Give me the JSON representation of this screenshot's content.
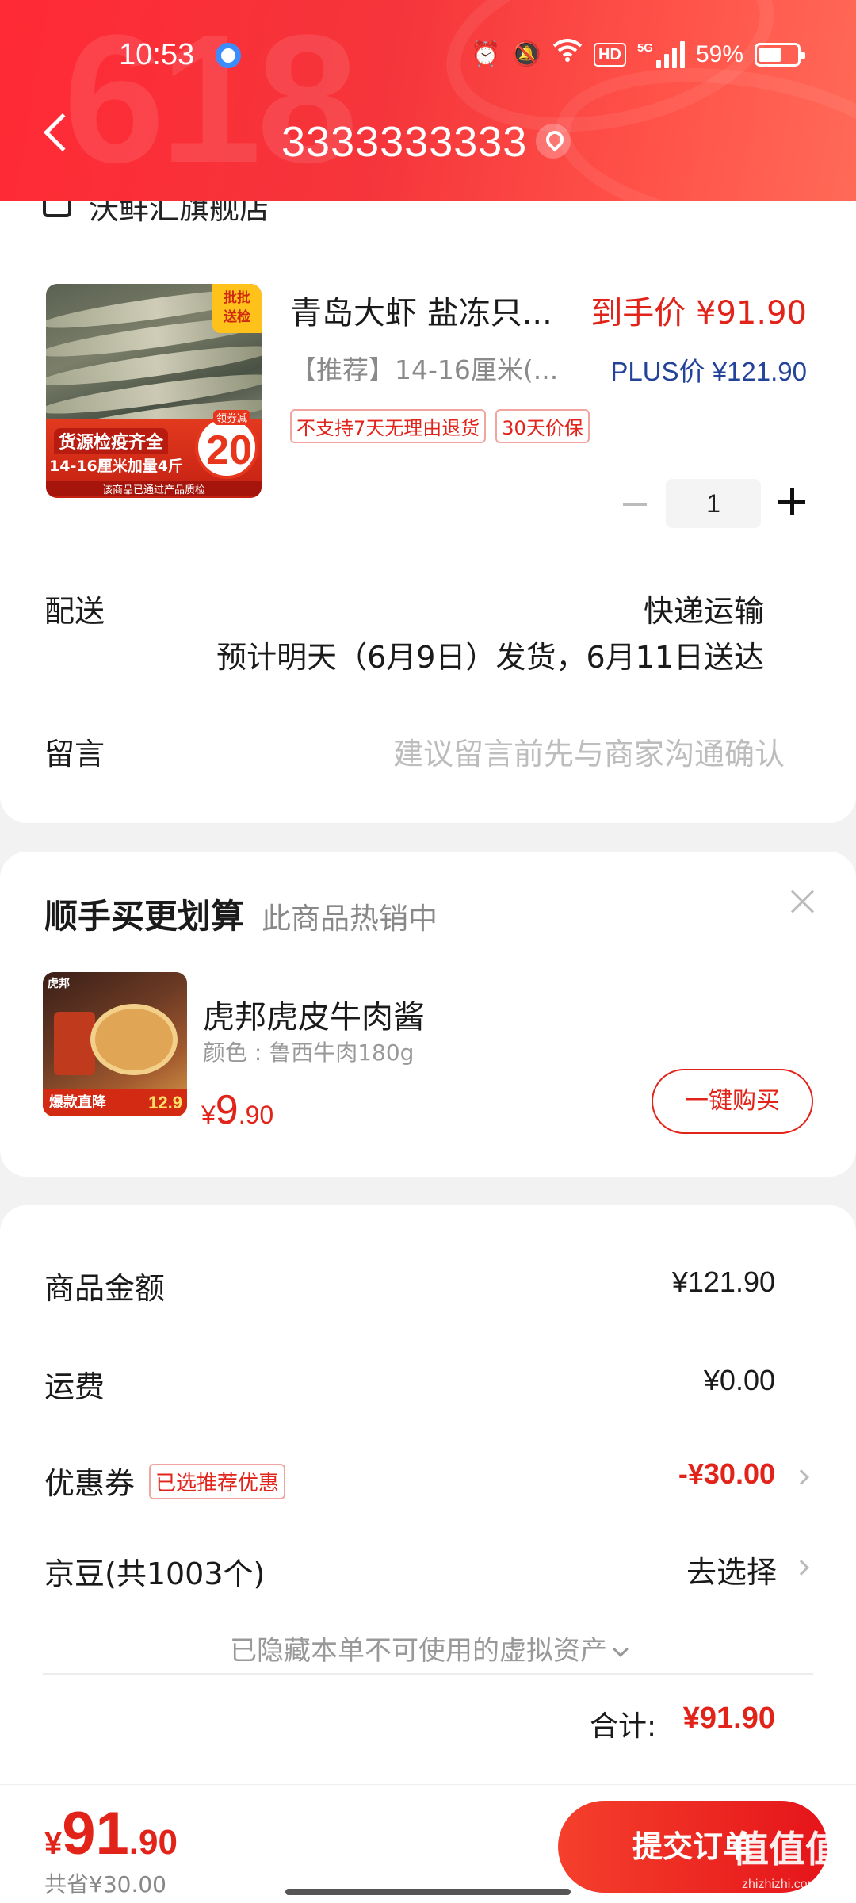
{
  "status_bar": {
    "time": "10:53",
    "hd": "HD",
    "network": "5G",
    "battery": "59%",
    "battery_level": 0.59
  },
  "header": {
    "title": "3333333333",
    "background_deco": "618",
    "accent_color": "#f5353b"
  },
  "store": {
    "name": "沃鲜汇旗舰店"
  },
  "product": {
    "title": "青岛大虾 盐冻只...",
    "final_price": "到手价 ¥91.90",
    "spec": "【推荐】14-16厘米(...",
    "plus_price": "PLUS价 ¥121.90",
    "tags": [
      "不支持7天无理由退货",
      "30天价保"
    ],
    "quantity": "1",
    "image": {
      "corner_tag": "批批\n送检",
      "banner_line1": "货源检疫齐全",
      "banner_line2": "14-16厘米加量4斤",
      "banner_note": "该商品已通过产品质检",
      "coupon_label": "领券减",
      "coupon_value": "20"
    }
  },
  "delivery": {
    "label": "配送",
    "method": "快递运输",
    "estimate": "预计明天（6月9日）发货，6月11日送达"
  },
  "note": {
    "label": "留言",
    "placeholder": "建议留言前先与商家沟通确认"
  },
  "recommendation": {
    "title": "顺手买更划算",
    "subtitle": "此商品热销中",
    "item": {
      "name": "虎邦虎皮牛肉酱",
      "spec": "颜色 : 鲁西牛肉180g",
      "price_currency": "¥",
      "price_int": "9",
      "price_dec": ".90",
      "image_brand": "虎邦",
      "image_strip": "爆款直降",
      "image_price": "12.9"
    },
    "buy_label": "一键购买"
  },
  "summary": {
    "goods_label": "商品金额",
    "goods_value": "¥121.90",
    "shipping_label": "运费",
    "shipping_value": "¥0.00",
    "coupon_label": "优惠券",
    "coupon_badge": "已选推荐优惠",
    "coupon_value": "-¥30.00",
    "beans_label": "京豆(共1003个)",
    "beans_action": "去选择",
    "hidden_assets": "已隐藏本单不可使用的虚拟资产",
    "total_label": "合计:",
    "total_value": "¥91.90"
  },
  "bottom_bar": {
    "price_currency": "¥",
    "price_int": "91",
    "price_dec": ".90",
    "saved": "共省¥30.00",
    "submit_label": "提交订单"
  },
  "watermark": {
    "text": "值值值",
    "sub": "zhizhizhi.com"
  }
}
